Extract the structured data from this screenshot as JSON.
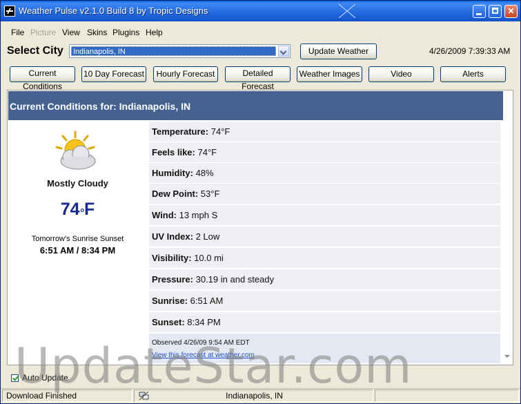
{
  "window": {
    "title": "Weather Pulse v2.1.0 Build 8 by Tropic Designs"
  },
  "menu": [
    {
      "label": "File",
      "disabled": false
    },
    {
      "label": "Picture",
      "disabled": true
    },
    {
      "label": "View",
      "disabled": false
    },
    {
      "label": "Skins",
      "disabled": false
    },
    {
      "label": "Plugins",
      "disabled": false
    },
    {
      "label": "Help",
      "disabled": false
    }
  ],
  "city": {
    "label": "Select City",
    "selected": "Indianapolis, IN",
    "update_label": "Update Weather",
    "timestamp": "4/26/2009 7:39:33 AM"
  },
  "tabs": [
    {
      "label": "Current Conditions"
    },
    {
      "label": "10 Day Forecast"
    },
    {
      "label": "Hourly Forecast"
    },
    {
      "label": "Detailed Forecast"
    },
    {
      "label": "Weather Images"
    },
    {
      "label": "Video"
    },
    {
      "label": "Alerts"
    }
  ],
  "current": {
    "header": "Current Conditions for: Indianapolis, IN",
    "condition_icon": "partly-cloudy-sun-icon",
    "condition": "Mostly Cloudy",
    "temp_value": "74",
    "temp_degree": "o",
    "temp_unit": "F",
    "sun_label": "Tomorrow's Sunrise Sunset",
    "sun_value": "6:51 AM / 8:34 PM",
    "details": [
      {
        "label": "Temperature:",
        "value": "74°F"
      },
      {
        "label": "Feels like:",
        "value": "74°F"
      },
      {
        "label": "Humidity:",
        "value": "48%"
      },
      {
        "label": "Dew Point:",
        "value": "53°F"
      },
      {
        "label": "Wind:",
        "value": "13 mph S"
      },
      {
        "label": "UV Index:",
        "value": "2 Low"
      },
      {
        "label": "Visibility:",
        "value": "10.0 mi"
      },
      {
        "label": "Pressure:",
        "value": "30.19 in and steady"
      },
      {
        "label": "Sunrise:",
        "value": "6:51 AM"
      },
      {
        "label": "Sunset:",
        "value": "8:34 PM"
      }
    ],
    "observed": "Observed 4/26/09 9:54 AM EDT",
    "link": "View this forecast at weather.com"
  },
  "auto_update": {
    "label": "Auto Update",
    "checked": true
  },
  "status": {
    "left": "Download Finished",
    "city": "Indianapolis, IN",
    "icon": "network-icon"
  },
  "watermark": "UpdateStar.com",
  "colors": {
    "header": "#44618f",
    "temp": "#1a2a8c",
    "row": "#eeeff3",
    "titlebar": "#2c74e8"
  }
}
